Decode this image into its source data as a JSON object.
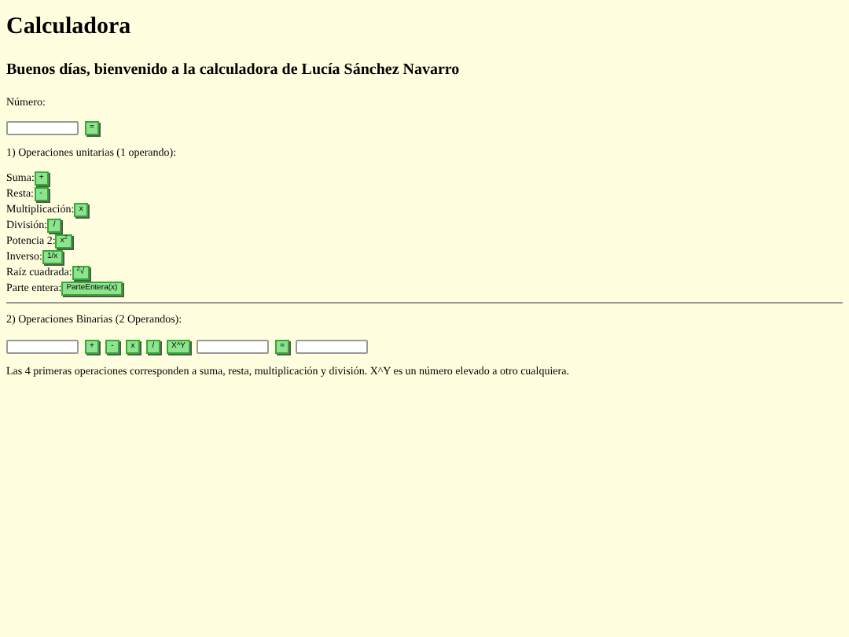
{
  "title": "Calculadora",
  "greeting": "Buenos días, bienvenido a la calculadora de Lucía Sánchez Navarro",
  "number_label": "Número:",
  "equals_button": "=",
  "unary_heading": "1) Operaciones unitarias (1 operando):",
  "unary": [
    {
      "label": "Suma:",
      "button": "+"
    },
    {
      "label": "Resta:",
      "button": "-"
    },
    {
      "label": "Multiplicación:",
      "button": "x"
    },
    {
      "label": "División:",
      "button": "/"
    },
    {
      "label": "Potencia 2:",
      "button": "x$^{2}$"
    },
    {
      "label": "Inverso:",
      "button": "1/x"
    },
    {
      "label": "Raíz cuadrada:",
      "button": "$^{2}$√"
    },
    {
      "label": "Parte entera:",
      "button": "ParteEntera(x)"
    }
  ],
  "binary_heading": "2) Operaciones Binarias (2 Operandos):",
  "binary_operators": [
    "+",
    "-",
    "x",
    "/",
    "X^Y"
  ],
  "binary_equals": "=",
  "note": "Las 4 primeras operaciones corresponden a suma, resta, multiplicación y división. X^Y es un número elevado a otro cualquiera."
}
